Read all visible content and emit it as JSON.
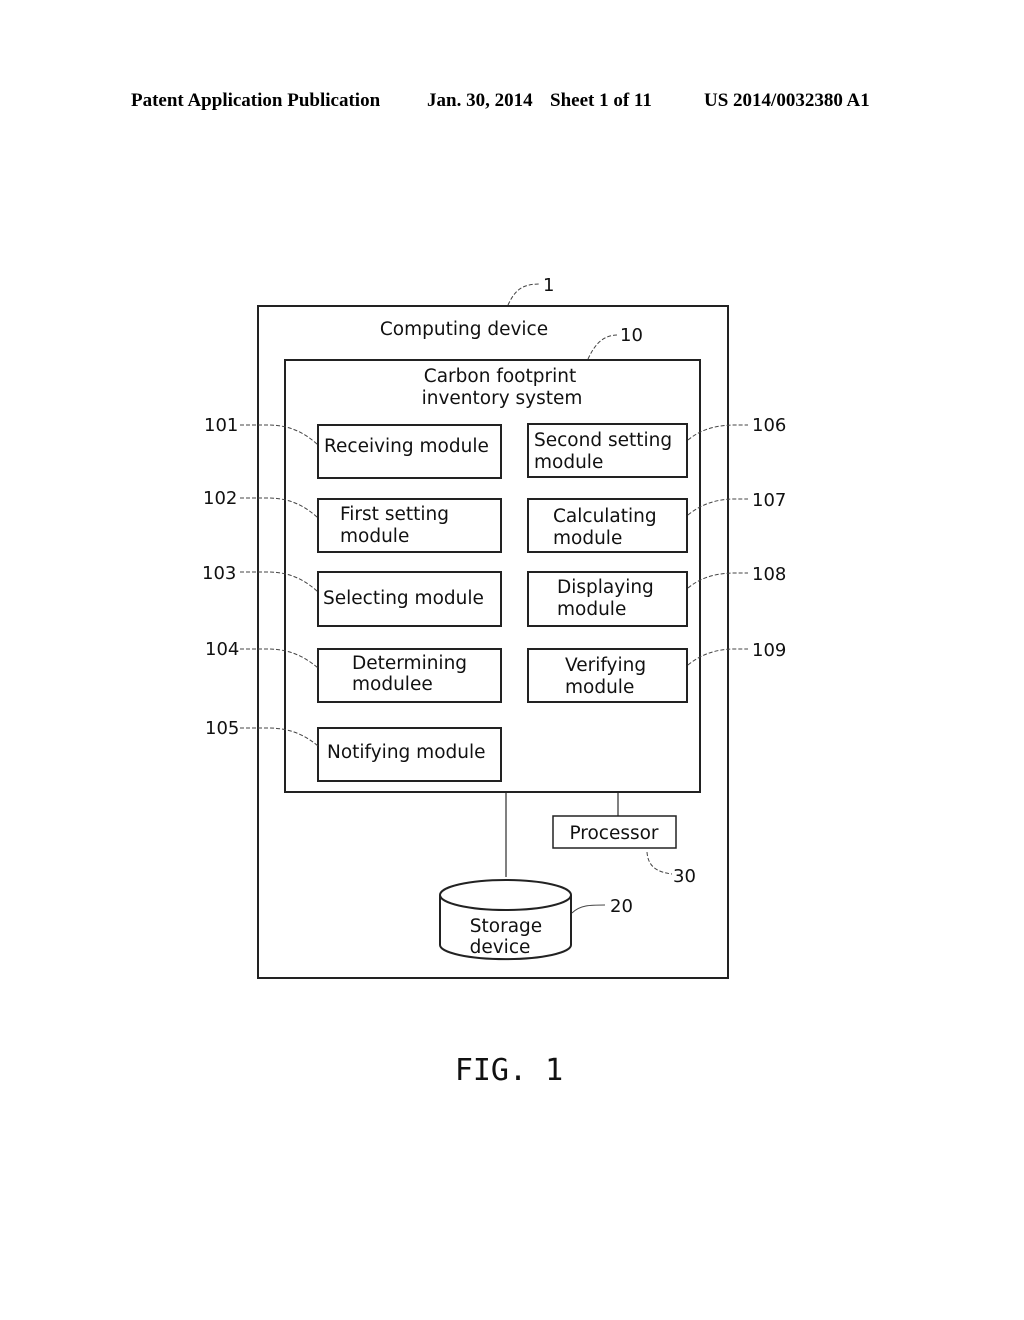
{
  "header": {
    "publication": "Patent Application Publication",
    "date": "Jan. 30, 2014",
    "sheet": "Sheet 1 of 11",
    "number": "US 2014/0032380 A1"
  },
  "diagram": {
    "computing_device": {
      "label": "Computing device",
      "ref": "1"
    },
    "system": {
      "label_line1": "Carbon footprint",
      "label_line2": "inventory system",
      "ref": "10"
    },
    "modules": [
      {
        "ref": "101",
        "line1": "Receiving module",
        "line2": ""
      },
      {
        "ref": "102",
        "line1": "First setting",
        "line2": "module"
      },
      {
        "ref": "103",
        "line1": "Selecting module",
        "line2": ""
      },
      {
        "ref": "104",
        "line1": "Determining",
        "line2": "modulee"
      },
      {
        "ref": "105",
        "line1": "Notifying module",
        "line2": ""
      },
      {
        "ref": "106",
        "line1": "Second setting",
        "line2": "module"
      },
      {
        "ref": "107",
        "line1": "Calculating",
        "line2": "module"
      },
      {
        "ref": "108",
        "line1": "Displaying",
        "line2": "module"
      },
      {
        "ref": "109",
        "line1": "Verifying",
        "line2": "module"
      }
    ],
    "processor": {
      "label": "Processor",
      "ref": "30"
    },
    "storage": {
      "label_line1": "Storage",
      "label_line2": "device",
      "ref": "20"
    }
  },
  "figure_caption": "FIG. 1"
}
